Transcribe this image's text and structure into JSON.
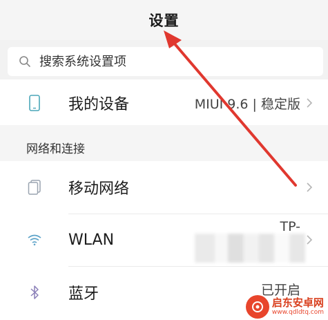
{
  "header": {
    "title": "设置"
  },
  "search": {
    "placeholder": "搜索系统设置项",
    "value": ""
  },
  "device": {
    "label": "我的设备",
    "value": "MIUI 9.6 | 稳定版"
  },
  "section_network": {
    "label": "网络和连接"
  },
  "network_rows": [
    {
      "label": "移动网络",
      "value": ""
    },
    {
      "label": "WLAN",
      "value": "TP-"
    },
    {
      "label": "蓝牙",
      "value": "已开启"
    }
  ],
  "watermark": {
    "text": "启东安卓网",
    "url": "www.qdldtq.com"
  },
  "colors": {
    "arrow": "#e0382f",
    "wifi": "#5aa2c8",
    "icon_gray": "#9aa4b0",
    "bluetooth": "#8a7fb8"
  },
  "icons": {
    "search": "search-icon",
    "device": "phone-icon",
    "mobile": "sim-card-icon",
    "wlan": "wifi-icon",
    "bluetooth": "bluetooth-icon",
    "chevron": "chevron-right-icon"
  }
}
